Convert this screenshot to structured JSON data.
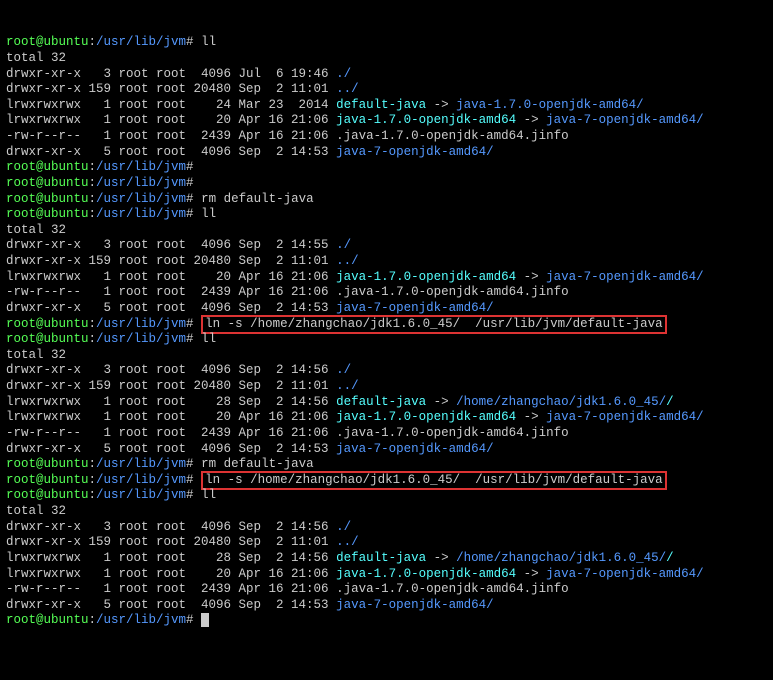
{
  "user": "root",
  "host": "ubuntu",
  "cwd": "/usr/lib/jvm",
  "sym": "#",
  "cmd": {
    "ll": "ll",
    "rm": "rm default-java",
    "empty": "",
    "ln": "ln -s /home/zhangchao/jdk1.6.0_45/  /usr/lib/jvm/default-java"
  },
  "total": "total 32",
  "ls1": [
    {
      "perm": "drwxr-xr-x",
      "ln": "  3",
      "own": "root root",
      "size": " 4096",
      "date": "Jul  6 19:46",
      "name": "./",
      "type": "b"
    },
    {
      "perm": "drwxr-xr-x",
      "ln": "159",
      "own": "root root",
      "size": "20480",
      "date": "Sep  2 11:01",
      "name": "../",
      "type": "b"
    },
    {
      "perm": "lrwxrwxrwx",
      "ln": "  1",
      "own": "root root",
      "size": "   24",
      "date": "Mar 23  2014",
      "name": "default-java",
      "type": "c",
      "arrow": " -> ",
      "tgt": "java-1.7.0-openjdk-amd64/",
      "ttype": "b"
    },
    {
      "perm": "lrwxrwxrwx",
      "ln": "  1",
      "own": "root root",
      "size": "   20",
      "date": "Apr 16 21:06",
      "name": "java-1.7.0-openjdk-amd64",
      "type": "c",
      "arrow": " -> ",
      "tgt": "java-7-openjdk-amd64/",
      "ttype": "b"
    },
    {
      "perm": "-rw-r--r--",
      "ln": "  1",
      "own": "root root",
      "size": " 2439",
      "date": "Apr 16 21:06",
      "name": ".java-1.7.0-openjdk-amd64.jinfo",
      "type": "w"
    },
    {
      "perm": "drwxr-xr-x",
      "ln": "  5",
      "own": "root root",
      "size": " 4096",
      "date": "Sep  2 14:53",
      "name": "java-7-openjdk-amd64/",
      "type": "b"
    }
  ],
  "ls2": [
    {
      "perm": "drwxr-xr-x",
      "ln": "  3",
      "own": "root root",
      "size": " 4096",
      "date": "Sep  2 14:55",
      "name": "./",
      "type": "b"
    },
    {
      "perm": "drwxr-xr-x",
      "ln": "159",
      "own": "root root",
      "size": "20480",
      "date": "Sep  2 11:01",
      "name": "../",
      "type": "b"
    },
    {
      "perm": "lrwxrwxrwx",
      "ln": "  1",
      "own": "root root",
      "size": "   20",
      "date": "Apr 16 21:06",
      "name": "java-1.7.0-openjdk-amd64",
      "type": "c",
      "arrow": " -> ",
      "tgt": "java-7-openjdk-amd64/",
      "ttype": "b"
    },
    {
      "perm": "-rw-r--r--",
      "ln": "  1",
      "own": "root root",
      "size": " 2439",
      "date": "Apr 16 21:06",
      "name": ".java-1.7.0-openjdk-amd64.jinfo",
      "type": "w"
    },
    {
      "perm": "drwxr-xr-x",
      "ln": "  5",
      "own": "root root",
      "size": " 4096",
      "date": "Sep  2 14:53",
      "name": "java-7-openjdk-amd64/",
      "type": "b"
    }
  ],
  "ls3": [
    {
      "perm": "drwxr-xr-x",
      "ln": "  3",
      "own": "root root",
      "size": " 4096",
      "date": "Sep  2 14:56",
      "name": "./",
      "type": "b"
    },
    {
      "perm": "drwxr-xr-x",
      "ln": "159",
      "own": "root root",
      "size": "20480",
      "date": "Sep  2 11:01",
      "name": "../",
      "type": "b"
    },
    {
      "perm": "lrwxrwxrwx",
      "ln": "  1",
      "own": "root root",
      "size": "   28",
      "date": "Sep  2 14:56",
      "name": "default-java",
      "type": "c",
      "arrow": " -> ",
      "tgt": "/home/zhangchao/jdk1.6.0_45/",
      "ttype": "b",
      "tail": "/"
    },
    {
      "perm": "lrwxrwxrwx",
      "ln": "  1",
      "own": "root root",
      "size": "   20",
      "date": "Apr 16 21:06",
      "name": "java-1.7.0-openjdk-amd64",
      "type": "c",
      "arrow": " -> ",
      "tgt": "java-7-openjdk-amd64/",
      "ttype": "b"
    },
    {
      "perm": "-rw-r--r--",
      "ln": "  1",
      "own": "root root",
      "size": " 2439",
      "date": "Apr 16 21:06",
      "name": ".java-1.7.0-openjdk-amd64.jinfo",
      "type": "w"
    },
    {
      "perm": "drwxr-xr-x",
      "ln": "  5",
      "own": "root root",
      "size": " 4096",
      "date": "Sep  2 14:53",
      "name": "java-7-openjdk-amd64/",
      "type": "b"
    }
  ],
  "ls4": [
    {
      "perm": "drwxr-xr-x",
      "ln": "  3",
      "own": "root root",
      "size": " 4096",
      "date": "Sep  2 14:56",
      "name": "./",
      "type": "b"
    },
    {
      "perm": "drwxr-xr-x",
      "ln": "159",
      "own": "root root",
      "size": "20480",
      "date": "Sep  2 11:01",
      "name": "../",
      "type": "b"
    },
    {
      "perm": "lrwxrwxrwx",
      "ln": "  1",
      "own": "root root",
      "size": "   28",
      "date": "Sep  2 14:56",
      "name": "default-java",
      "type": "c",
      "arrow": " -> ",
      "tgt": "/home/zhangchao/jdk1.6.0_45/",
      "ttype": "b",
      "tail": "/"
    },
    {
      "perm": "lrwxrwxrwx",
      "ln": "  1",
      "own": "root root",
      "size": "   20",
      "date": "Apr 16 21:06",
      "name": "java-1.7.0-openjdk-amd64",
      "type": "c",
      "arrow": " -> ",
      "tgt": "java-7-openjdk-amd64/",
      "ttype": "b"
    },
    {
      "perm": "-rw-r--r--",
      "ln": "  1",
      "own": "root root",
      "size": " 2439",
      "date": "Apr 16 21:06",
      "name": ".java-1.7.0-openjdk-amd64.jinfo",
      "type": "w"
    },
    {
      "perm": "drwxr-xr-x",
      "ln": "  5",
      "own": "root root",
      "size": " 4096",
      "date": "Sep  2 14:53",
      "name": "java-7-openjdk-amd64/",
      "type": "b"
    }
  ]
}
